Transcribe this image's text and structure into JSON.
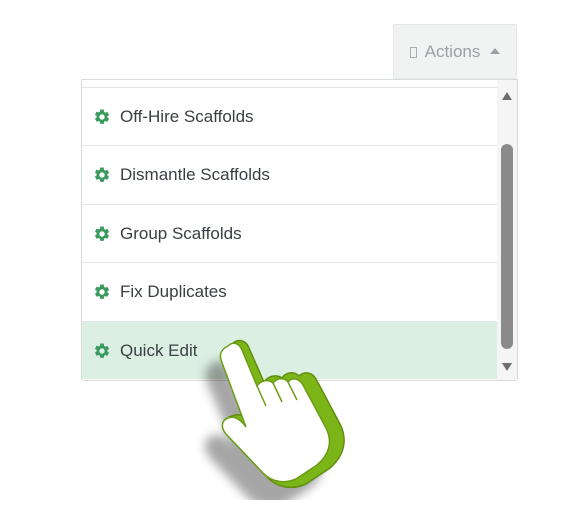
{
  "actions_button": {
    "label": "Actions",
    "icon": "square-outline-icon",
    "caret": "caret-up-icon"
  },
  "menu": {
    "items": [
      {
        "label": "Off-Hire Scaffolds",
        "icon": "gear-icon"
      },
      {
        "label": "Dismantle Scaffolds",
        "icon": "gear-icon"
      },
      {
        "label": "Group Scaffolds",
        "icon": "gear-icon"
      },
      {
        "label": "Fix Duplicates",
        "icon": "gear-icon"
      },
      {
        "label": "Quick Edit",
        "icon": "gear-icon",
        "highlighted": true
      }
    ]
  },
  "colors": {
    "gear": "#3b9a5e",
    "highlight": "#dcefe3",
    "hand_outline": "#7cb518"
  }
}
